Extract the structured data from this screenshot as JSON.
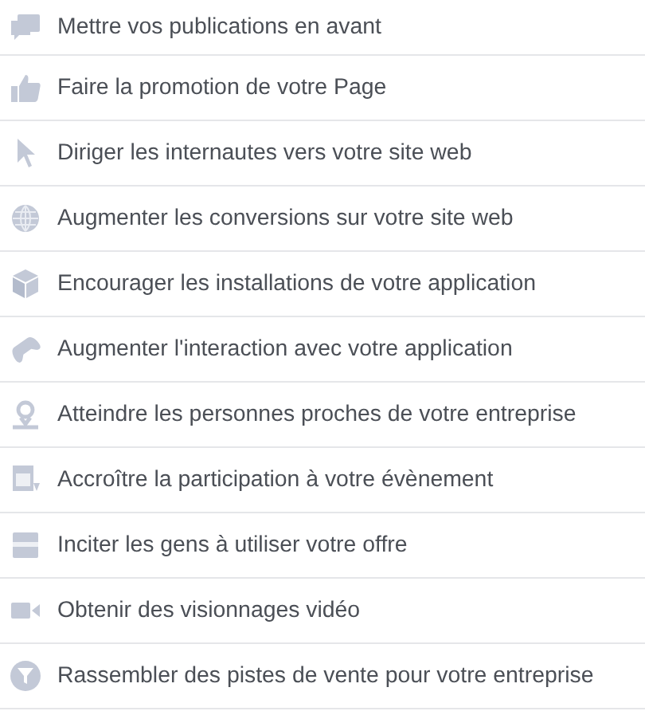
{
  "objectives": [
    {
      "kind": "posts",
      "label": "Mettre vos publications en avant"
    },
    {
      "kind": "like",
      "label": "Faire la promotion de votre Page"
    },
    {
      "kind": "cursor",
      "label": "Diriger les internautes vers votre site web"
    },
    {
      "kind": "globe",
      "label": "Augmenter les conversions sur votre site web"
    },
    {
      "kind": "cube",
      "label": "Encourager les installations de votre application"
    },
    {
      "kind": "gamepad",
      "label": "Augmenter l'interaction avec votre application"
    },
    {
      "kind": "pin",
      "label": "Atteindre les personnes proches de votre entreprise"
    },
    {
      "kind": "calendar",
      "label": "Accroître la participation à votre évènement"
    },
    {
      "kind": "offer",
      "label": "Inciter les gens à utiliser votre offre"
    },
    {
      "kind": "video",
      "label": "Obtenir des visionnages vidéo"
    },
    {
      "kind": "filter",
      "label": "Rassembler des pistes de vente pour votre entreprise"
    }
  ]
}
